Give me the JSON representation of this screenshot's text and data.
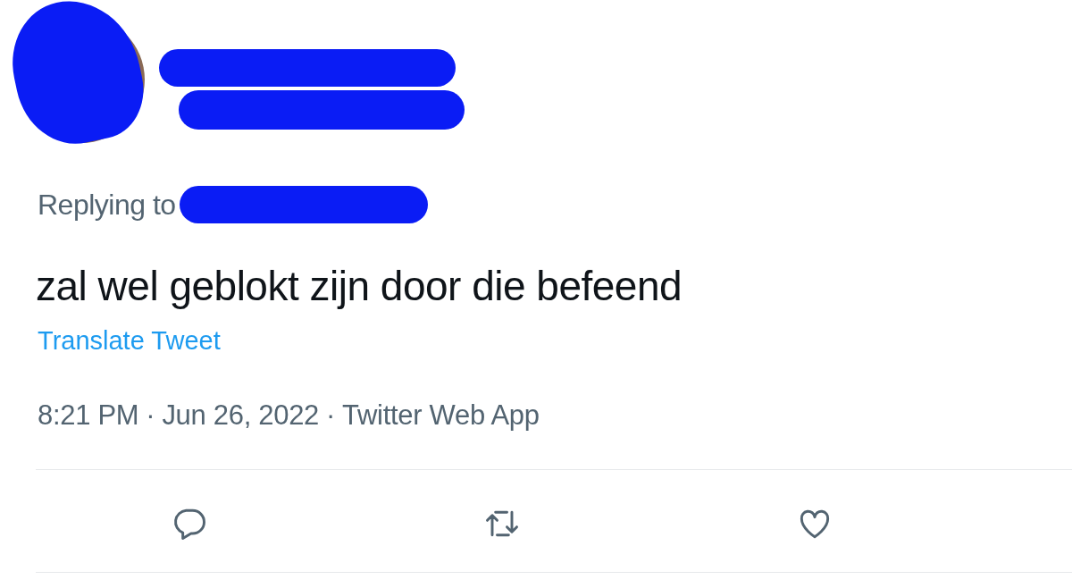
{
  "tweet": {
    "reply_label": "Replying to",
    "text": "zal wel geblokt zijn door die befeend",
    "translate_link": "Translate Tweet",
    "time": "8:21 PM",
    "date": "Jun 26, 2022",
    "source": "Twitter Web App",
    "separator": "·"
  },
  "actions": [
    {
      "kind": "reply"
    },
    {
      "kind": "retweet"
    },
    {
      "kind": "like"
    }
  ]
}
